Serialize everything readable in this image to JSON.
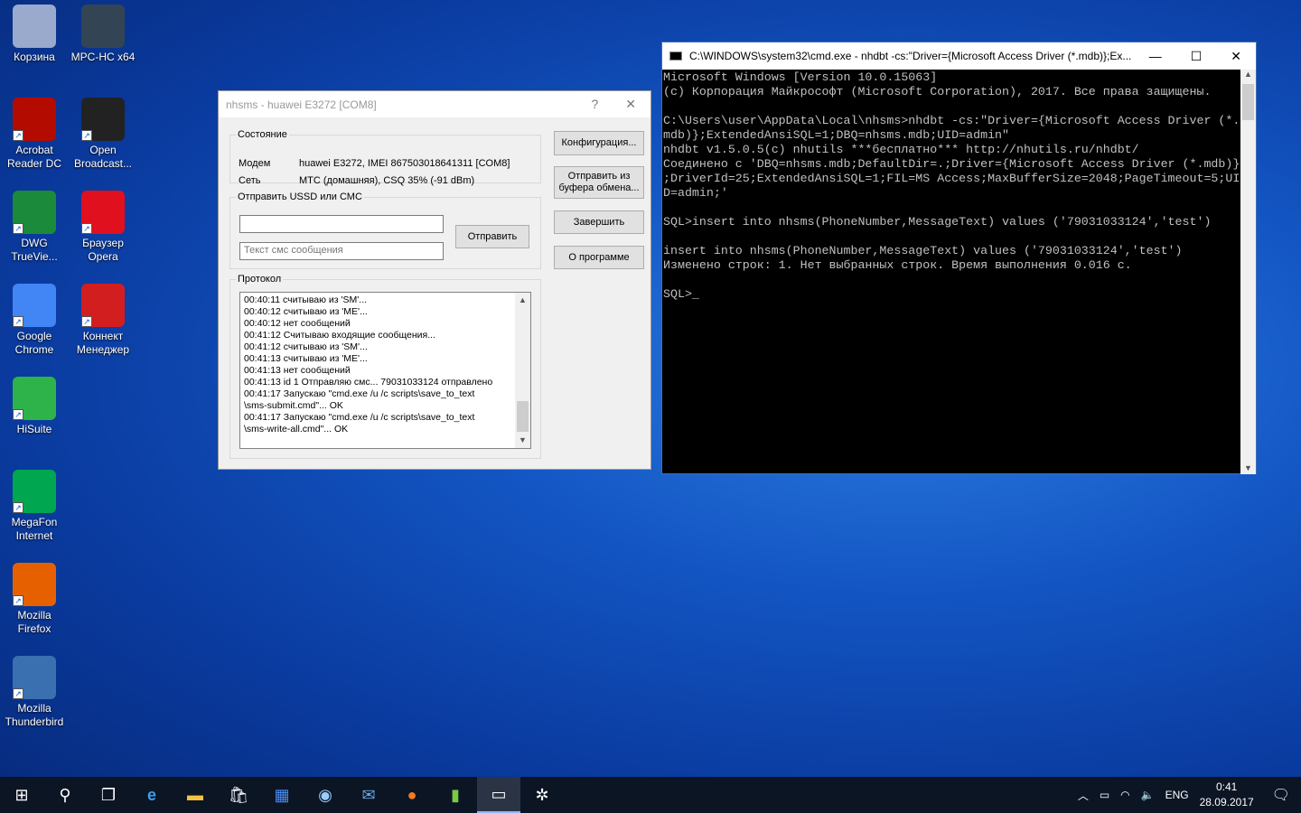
{
  "desktop": {
    "icons": [
      {
        "label": "Корзина",
        "color": "#9ac"
      },
      {
        "label": "MPC-HC x64",
        "color": "#345"
      },
      {
        "label": "Acrobat Reader DC",
        "color": "#b30b00"
      },
      {
        "label": "Open Broadcast...",
        "color": "#222"
      },
      {
        "label": "DWG TrueVie...",
        "color": "#1b8a3a"
      },
      {
        "label": "Браузер Opera",
        "color": "#e0101e"
      },
      {
        "label": "Google Chrome",
        "color": "#4285f4"
      },
      {
        "label": "Коннект Менеджер",
        "color": "#d21e1e"
      },
      {
        "label": "HiSuite",
        "color": "#2db34a"
      },
      {
        "label": "MegaFon Internet",
        "color": "#00a650"
      },
      {
        "label": "Mozilla Firefox",
        "color": "#e66000"
      },
      {
        "label": "Mozilla Thunderbird",
        "color": "#3a6fb0"
      }
    ]
  },
  "dialog": {
    "title": "nhsms - huawei E3272 [COM8]",
    "help": "?",
    "close": "✕",
    "status_legend": "Состояние",
    "modem_label": "Модем",
    "modem_value": "huawei E3272, IMEI 867503018641311 [COM8]",
    "net_label": "Сеть",
    "net_value": "МТС (домашняя), CSQ 35% (-91 dBm)",
    "send_legend": "Отправить USSD или СМС",
    "number_value": "",
    "sms_placeholder": "Текст смс сообщения",
    "send_button": "Отправить",
    "log_legend": "Протокол",
    "log": [
      "00:40:11 считываю из 'SM'...",
      "00:40:12 считываю из 'ME'...",
      "00:40:12 нет сообщений",
      "00:41:12 Считываю входящие сообщения...",
      "00:41:12 считываю из 'SM'...",
      "00:41:13 считываю из 'ME'...",
      "00:41:13 нет сообщений",
      "00:41:13 id 1 Отправляю смс... 79031033124 отправлено",
      "00:41:17 Запускаю \"cmd.exe /u /c scripts\\save_to_text",
      "\\sms-submit.cmd\"... OK",
      "00:41:17 Запускаю \"cmd.exe /u /c scripts\\save_to_text",
      "\\sms-write-all.cmd\"... OK"
    ],
    "buttons": {
      "config": "Конфигурация...",
      "clipboard": "Отправить из буфера обмена...",
      "exit": "Завершить",
      "about": "О программе"
    }
  },
  "cmd": {
    "title": "C:\\WINDOWS\\system32\\cmd.exe - nhdbt  -cs:\"Driver={Microsoft Access Driver (*.mdb)};Ex...",
    "lines": [
      "Microsoft Windows [Version 10.0.15063]",
      "(c) Корпорация Майкрософт (Microsoft Corporation), 2017. Все права защищены.",
      "",
      "C:\\Users\\user\\AppData\\Local\\nhsms>nhdbt -cs:\"Driver={Microsoft Access Driver (*.",
      "mdb)};ExtendedAnsiSQL=1;DBQ=nhsms.mdb;UID=admin\"",
      "nhdbt v1.5.0.5(c) nhutils ***бесплатно*** http://nhutils.ru/nhdbt/",
      "Соединено с 'DBQ=nhsms.mdb;DefaultDir=.;Driver={Microsoft Access Driver (*.mdb)}",
      ";DriverId=25;ExtendedAnsiSQL=1;FIL=MS Access;MaxBufferSize=2048;PageTimeout=5;UI",
      "D=admin;'",
      "",
      "SQL>insert into nhsms(PhoneNumber,MessageText) values ('79031033124','test')",
      "",
      "insert into nhsms(PhoneNumber,MessageText) values ('79031033124','test')",
      "Изменено строк: 1. Нет выбранных строк. Время выполнения 0.016 с.",
      "",
      "SQL>_"
    ]
  },
  "taskbar": {
    "lang": "ENG",
    "time": "0:41",
    "date": "28.09.2017"
  }
}
